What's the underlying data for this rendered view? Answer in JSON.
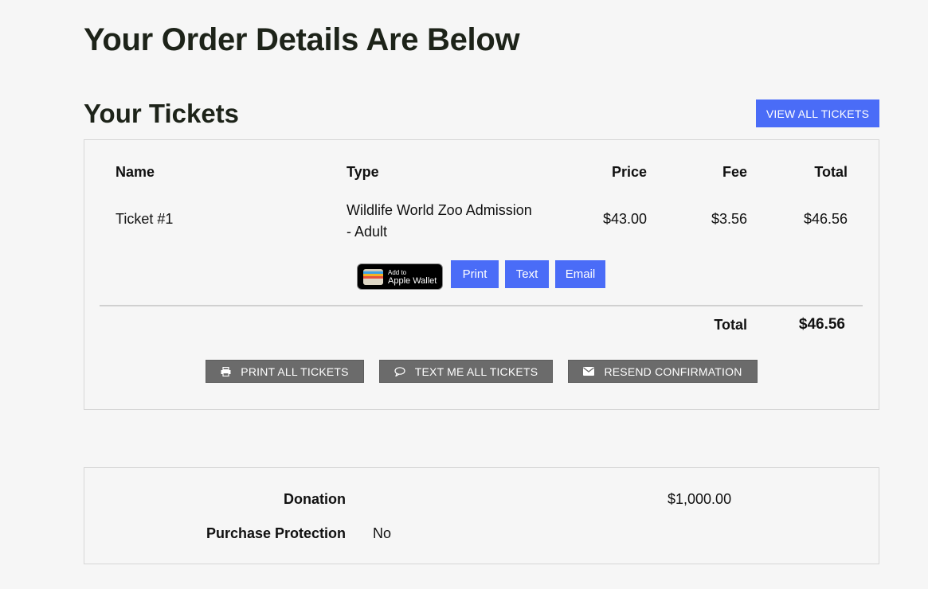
{
  "page": {
    "title": "Your Order Details Are Below"
  },
  "tickets_section": {
    "title": "Your Tickets",
    "view_all_label": "VIEW ALL TICKETS",
    "columns": {
      "name": "Name",
      "type": "Type",
      "price": "Price",
      "fee": "Fee",
      "total": "Total"
    },
    "rows": [
      {
        "name": "Ticket #1",
        "type_line1": "Wildlife World Zoo Admission",
        "type_line2": "- Adult",
        "price": "$43.00",
        "fee": "$3.56",
        "total": "$46.56",
        "wallet_small": "Add to",
        "wallet_big": "Apple Wallet",
        "print_label": "Print",
        "text_label": "Text",
        "email_label": "Email"
      }
    ],
    "grand_total_label": "Total",
    "grand_total_value": "$46.56",
    "actions": {
      "print_all": "PRINT ALL TICKETS",
      "text_all": "TEXT ME ALL TICKETS",
      "resend": "RESEND CONFIRMATION"
    }
  },
  "summary": {
    "donation_label": "Donation",
    "donation_value": "$1,000.00",
    "protection_label": "Purchase Protection",
    "protection_value": "No"
  },
  "colors": {
    "accent": "#4a6cf7",
    "secondary_button": "#6b6b6b",
    "heading": "#1d2319",
    "background": "#f6f6f6"
  },
  "icons": {
    "print": "printer-icon",
    "text": "speech-bubble-icon",
    "resend": "envelope-icon",
    "wallet": "apple-wallet-icon"
  }
}
